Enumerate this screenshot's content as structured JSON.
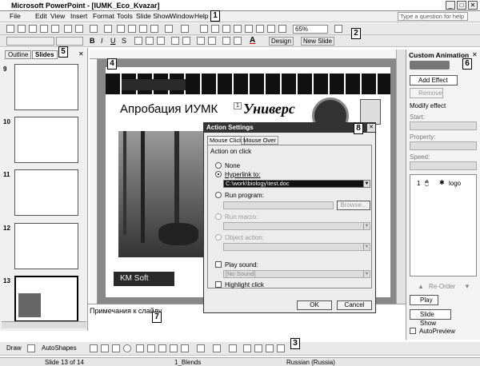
{
  "window": {
    "title": "Microsoft PowerPoint - [IUMK_Eco_Kvazar]"
  },
  "menu": {
    "items": [
      "File",
      "Edit",
      "View",
      "Insert",
      "Format",
      "Tools",
      "Slide Show",
      "Window",
      "Help"
    ],
    "help_placeholder": "Type a question for help"
  },
  "toolbar": {
    "zoom": "65%",
    "design_label": "Design",
    "new_slide_label": "New Slide"
  },
  "callouts": [
    "1",
    "2",
    "3",
    "4",
    "5",
    "6",
    "7",
    "8"
  ],
  "left_panel": {
    "tabs": [
      "Outline",
      "Slides"
    ],
    "slide_numbers": [
      "9",
      "10",
      "11",
      "12",
      "13"
    ]
  },
  "slide": {
    "title": "Апробация ИУМК",
    "number_badge": "1",
    "logo_text": "Универс",
    "caption": "KM Soft"
  },
  "notes": {
    "placeholder": "Примечания к слайду"
  },
  "dialog": {
    "title": "Action Settings",
    "tabs": [
      "Mouse Click",
      "Mouse Over"
    ],
    "group_label": "Action on click",
    "options": {
      "none": "None",
      "hyperlink": "Hyperlink to:",
      "hyperlink_value": "C:\\work\\biology\\test.doc",
      "run_program": "Run program:",
      "browse": "Browse...",
      "run_macro": "Run macro:",
      "object_action": "Object action:",
      "play_sound": "Play sound:",
      "sound_value": "[No Sound]",
      "highlight_click": "Highlight click"
    },
    "ok": "OK",
    "cancel": "Cancel"
  },
  "custom_animation": {
    "title": "Custom Animation",
    "add_effect": "Add Effect",
    "remove": "Remove",
    "modify_label": "Modify effect",
    "start_label": "Start:",
    "property_label": "Property:",
    "speed_label": "Speed:",
    "list_item_index": "1",
    "list_item_name": "logo",
    "reorder_label": "Re-Order",
    "play": "Play",
    "slide_show": "Slide Show",
    "autopreview": "AutoPreview"
  },
  "drawing_toolbar": {
    "draw": "Draw",
    "autoshapes": "AutoShapes"
  },
  "status": {
    "slide_count": "Slide 13 of 14",
    "design": "1_Blends",
    "language": "Russian (Russia)"
  }
}
